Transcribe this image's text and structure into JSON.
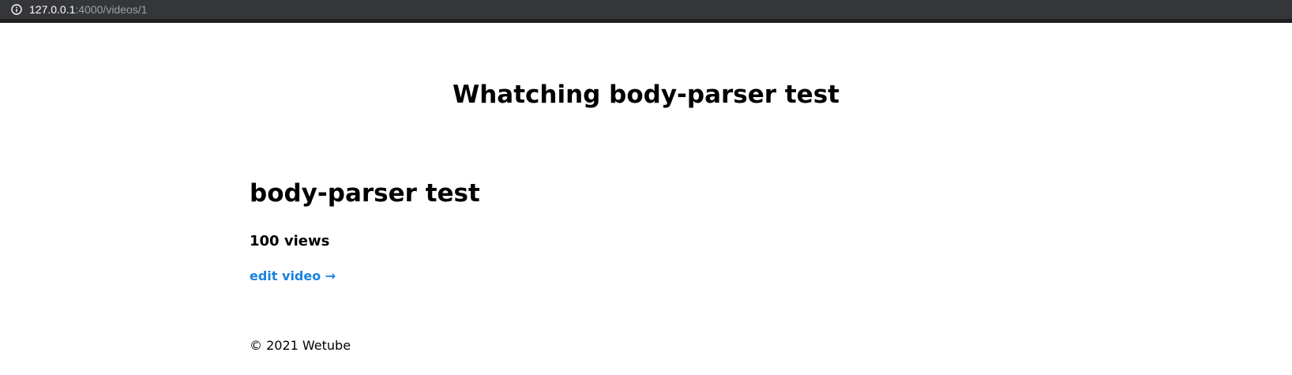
{
  "browser": {
    "url_host": "127.0.0.1",
    "url_path": ":4000/videos/1"
  },
  "page": {
    "title": "Whatching body-parser test"
  },
  "video": {
    "title": "body-parser test",
    "views": "100 views",
    "edit_link": "edit video →"
  },
  "footer": {
    "text": "© 2021 Wetube"
  },
  "colors": {
    "link": "#1a82e2",
    "urlbar_bg": "#35363a"
  },
  "icons": {
    "urlbar": "info-icon"
  }
}
